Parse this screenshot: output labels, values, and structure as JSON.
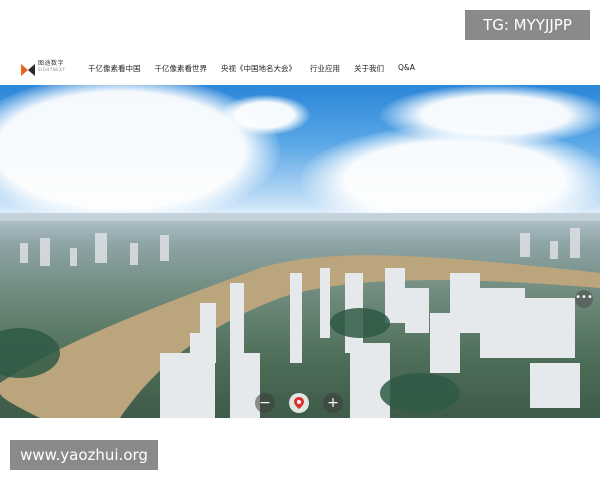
{
  "watermark_top": "TG: MYYJJPP",
  "watermark_bottom": "www.yaozhui.org",
  "logo": {
    "line1": "图途数字",
    "line2": "SIGHTNEXT",
    "icon": "brand-logo-icon"
  },
  "nav": {
    "items": [
      "千亿像素看中国",
      "千亿像素看世界",
      "央视《中国地名大会》",
      "行业应用",
      "关于我们",
      "Q&A"
    ]
  },
  "viewer": {
    "zoom_out_icon": "minus-icon",
    "zoom_in_icon": "plus-icon",
    "center_icon": "map-pin-icon",
    "more_icon": "ellipsis-icon",
    "zoom_out_label": "−",
    "zoom_in_label": "+",
    "more_label": "•••"
  }
}
